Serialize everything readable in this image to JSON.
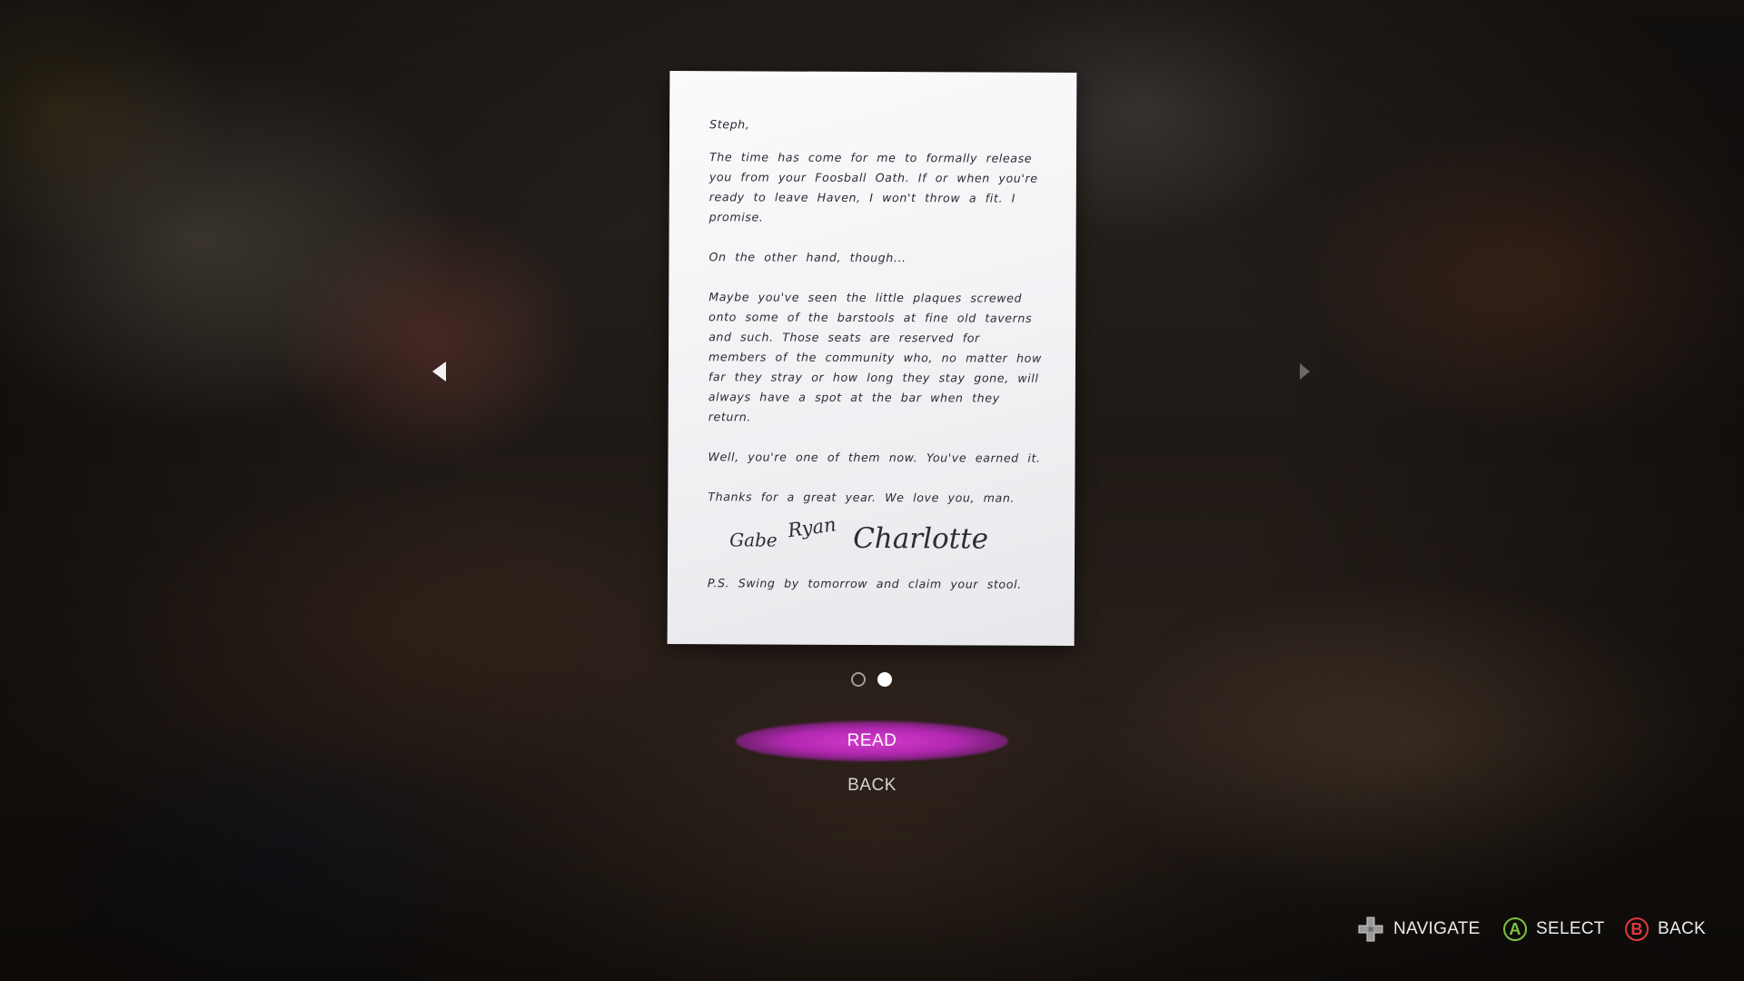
{
  "letter": {
    "greeting": "Steph,",
    "paragraphs": [
      "The time has come for me to formally release you from your Foosball Oath. If or when you're ready to leave Haven, I won't throw a fit. I promise.",
      "On the other hand, though...",
      "Maybe you've seen the little plaques screwed onto some of the barstools at fine old taverns and such. Those seats are reserved for members of the community who, no matter how far they stray or how long they stay gone, will always have a spot at the bar when they return.",
      "Well, you're one of them now. You've earned it.",
      "Thanks for a great year. We love you, man."
    ],
    "signatures": [
      "Gabe",
      "Ryan",
      "Charlotte"
    ],
    "postscript": "P.S. Swing by tomorrow and claim your stool."
  },
  "pager": {
    "current_page": 2,
    "total_pages": 2
  },
  "menu": {
    "read_label": "READ",
    "back_label": "BACK",
    "highlight_color": "#c63bc8"
  },
  "hints": {
    "navigate": "NAVIGATE",
    "select": "SELECT",
    "back": "BACK",
    "select_button": "A",
    "back_button": "B",
    "navigate_icon": "dpad-icon",
    "select_color": "#7fc241",
    "back_color": "#e0383e"
  }
}
